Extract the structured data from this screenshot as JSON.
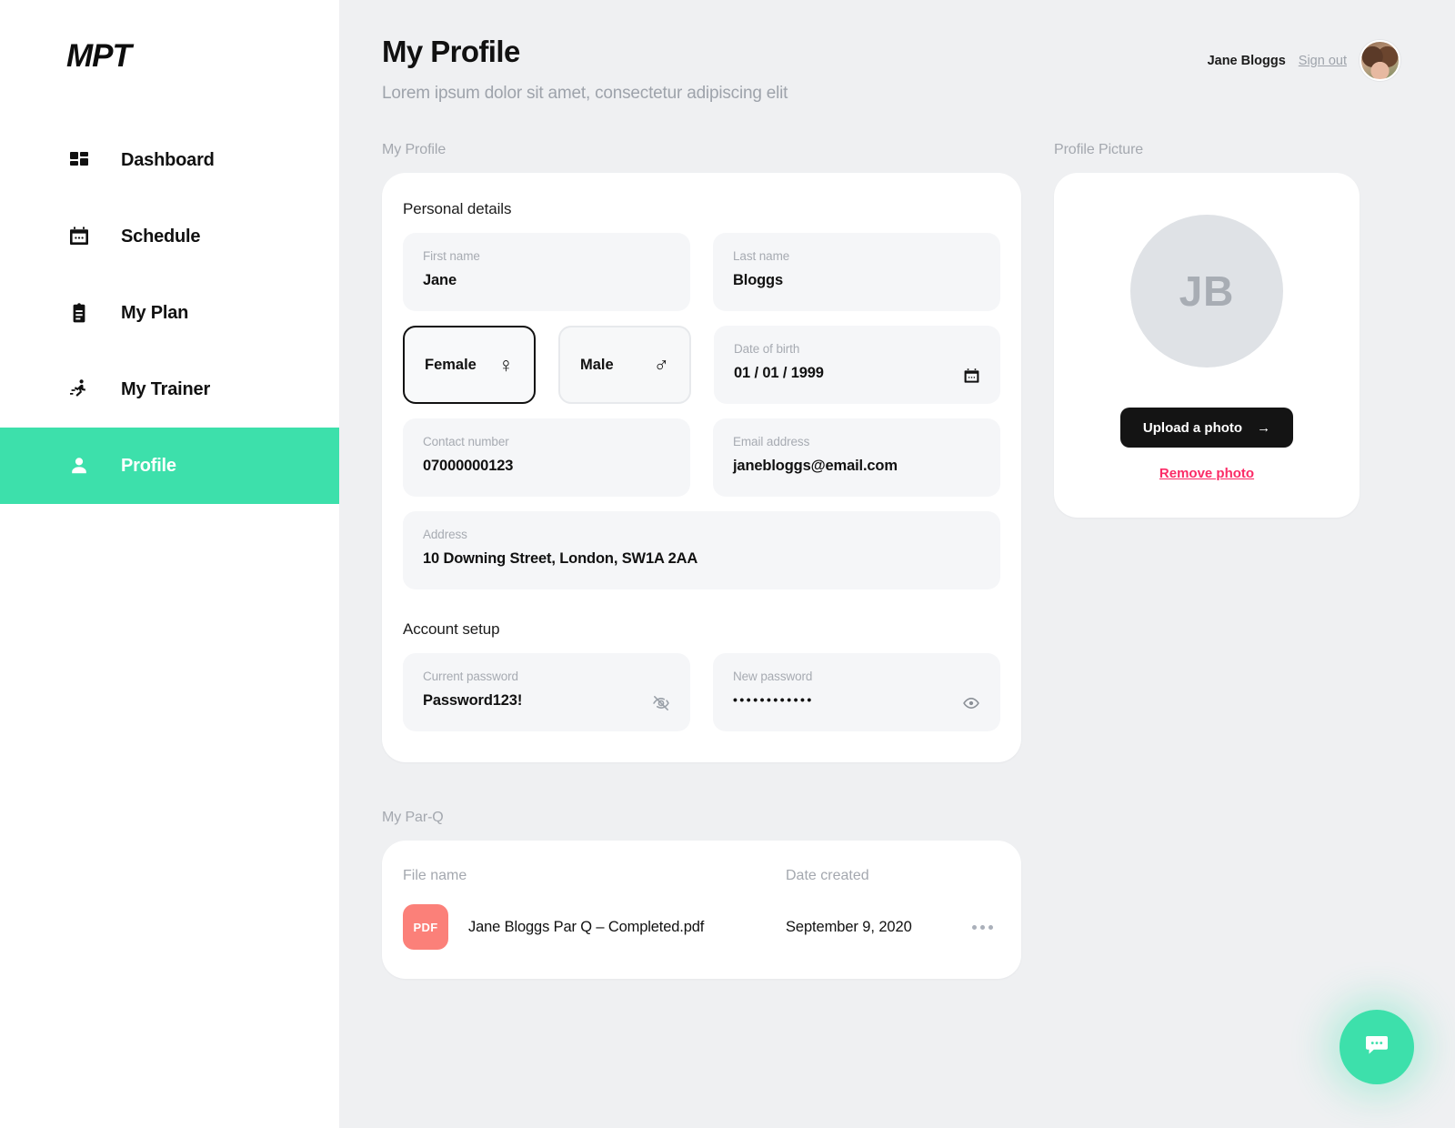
{
  "brand": {
    "logo": "MPT"
  },
  "sidebar": {
    "items": [
      {
        "label": "Dashboard",
        "icon": "dashboard-icon",
        "active": false
      },
      {
        "label": "Schedule",
        "icon": "calendar-icon",
        "active": false
      },
      {
        "label": "My Plan",
        "icon": "clipboard-icon",
        "active": false
      },
      {
        "label": "My Trainer",
        "icon": "runner-icon",
        "active": false
      },
      {
        "label": "Profile",
        "icon": "person-icon",
        "active": true
      }
    ]
  },
  "header": {
    "title": "My Profile",
    "subtitle": "Lorem ipsum dolor sit amet, consectetur adipiscing elit",
    "user_name": "Jane Bloggs",
    "sign_out": "Sign out",
    "avatar_alt": "user-avatar"
  },
  "profile_section": {
    "label": "My Profile",
    "personal_heading": "Personal details",
    "account_heading": "Account setup",
    "fields": {
      "first_name": {
        "label": "First name",
        "value": "Jane"
      },
      "last_name": {
        "label": "Last name",
        "value": "Bloggs"
      },
      "dob": {
        "label": "Date of birth",
        "value": "01 / 01 / 1999",
        "icon": "calendar-icon"
      },
      "contact": {
        "label": "Contact number",
        "value": "07000000123"
      },
      "email": {
        "label": "Email address",
        "value": "janebloggs@email.com"
      },
      "address": {
        "label": "Address",
        "value": "10 Downing Street, London, SW1A 2AA"
      },
      "current_password": {
        "label": "Current password",
        "value": "Password123!",
        "icon": "eye-off-icon"
      },
      "new_password": {
        "label": "New password",
        "value": "••••••••••••",
        "icon": "eye-icon"
      }
    },
    "gender": {
      "female": {
        "label": "Female",
        "symbol": "♀",
        "selected": true
      },
      "male": {
        "label": "Male",
        "symbol": "♂",
        "selected": false
      }
    }
  },
  "profile_picture": {
    "label": "Profile Picture",
    "initials": "JB",
    "upload_label": "Upload a photo",
    "upload_arrow": "→",
    "remove_label": "Remove photo"
  },
  "parq": {
    "label": "My Par-Q",
    "columns": {
      "file_name": "File name",
      "date_created": "Date created"
    },
    "rows": [
      {
        "badge": "PDF",
        "file_name": "Jane Bloggs Par Q – Completed.pdf",
        "date_created": "September 9, 2020"
      }
    ]
  },
  "chat": {
    "icon": "chat-bubble-icon"
  },
  "colors": {
    "accent_green": "#3de0ab",
    "page_bg": "#eff0f2",
    "card_bg": "#ffffff",
    "field_bg": "#f5f6f8",
    "pdf_badge": "#fb8079",
    "remove_link": "#fb2b66",
    "dark_button": "#141414"
  }
}
